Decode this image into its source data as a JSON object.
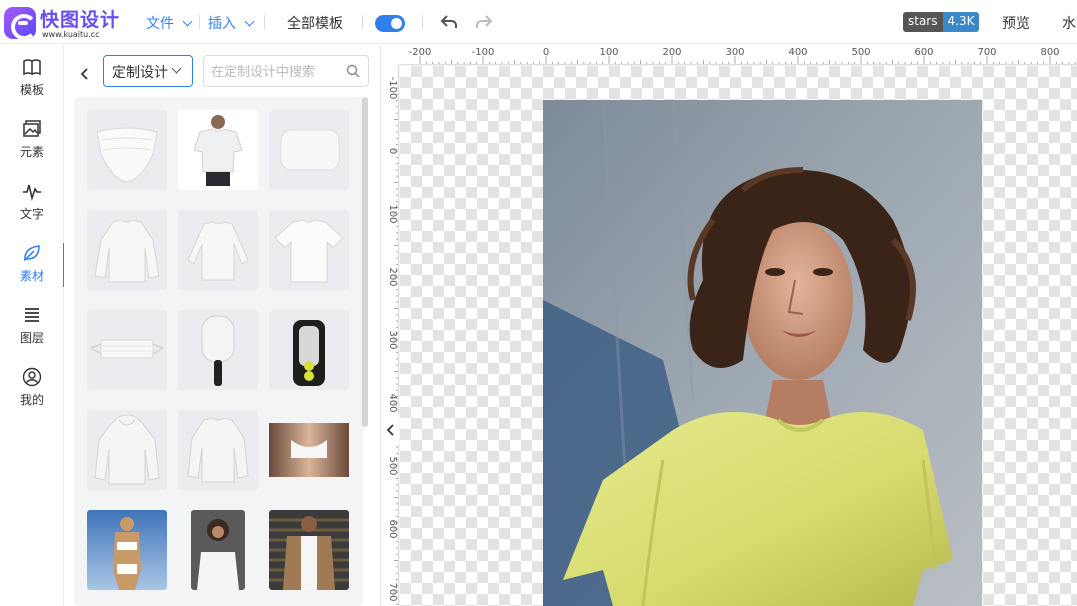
{
  "brand": {
    "name": "快图设计",
    "url": "www.kuaitu.cc"
  },
  "topbar": {
    "file_menu": "文件",
    "insert_menu": "插入",
    "all_templates": "全部模板",
    "stars_label": "stars",
    "stars_count": "4.3K",
    "preview": "预览",
    "watermark": "水"
  },
  "sidebar": {
    "items": [
      {
        "label": "模板",
        "icon": "book-icon"
      },
      {
        "label": "元素",
        "icon": "image-icon"
      },
      {
        "label": "文字",
        "icon": "pulse-icon"
      },
      {
        "label": "素材",
        "icon": "leaf-icon",
        "active": true
      },
      {
        "label": "图层",
        "icon": "layers-icon"
      },
      {
        "label": "我的",
        "icon": "user-icon"
      }
    ]
  },
  "panel": {
    "category": "定制设计",
    "search_placeholder": "在定制设计中搜索"
  },
  "ruler": {
    "h_labels": [
      "-200",
      "-100",
      "0",
      "100",
      "200",
      "300",
      "400",
      "500",
      "600",
      "700",
      "800"
    ],
    "v_labels": [
      "-100",
      "0",
      "100",
      "200",
      "300",
      "400",
      "500",
      "600",
      "700"
    ]
  },
  "colors": {
    "accent": "#2f80ed",
    "brand": "#6a4cf5"
  }
}
